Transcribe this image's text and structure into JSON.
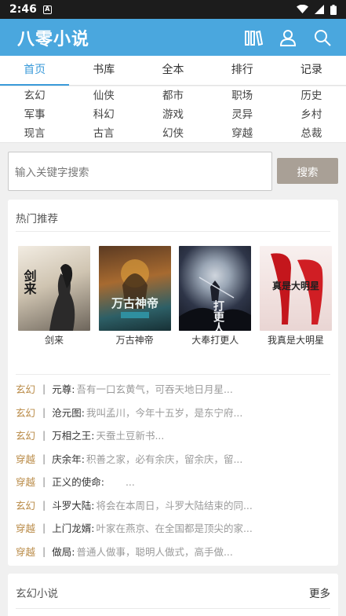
{
  "status": {
    "time": "2:46"
  },
  "app": {
    "title": "八零小说"
  },
  "tabs": [
    "首页",
    "书库",
    "全本",
    "排行",
    "记录"
  ],
  "categories": [
    "玄幻",
    "仙侠",
    "都市",
    "职场",
    "历史",
    "军事",
    "科幻",
    "游戏",
    "灵异",
    "乡村",
    "现言",
    "古言",
    "幻侠",
    "穿越",
    "总裁"
  ],
  "search": {
    "placeholder": "输入关键字搜索",
    "button": "搜索"
  },
  "hot": {
    "title": "热门推荐",
    "books": [
      {
        "name": "剑来",
        "cover_text": "剑来"
      },
      {
        "name": "万古神帝",
        "cover_text": "万古神帝"
      },
      {
        "name": "大奉打更人",
        "cover_text": "打更人"
      },
      {
        "name": "我真是大明星",
        "cover_text": "真是大明星"
      }
    ],
    "list": [
      {
        "tag": "玄幻",
        "title": "元尊:",
        "desc": "吾有一口玄黄气，可吞天地日月星..."
      },
      {
        "tag": "玄幻",
        "title": "沧元图:",
        "desc": "我叫孟川，今年十五岁，是东宁府..."
      },
      {
        "tag": "玄幻",
        "title": "万相之王:",
        "desc": "天蚕土豆新书..."
      },
      {
        "tag": "穿越",
        "title": "庆余年:",
        "desc": "积善之家，必有余庆，留余庆，留..."
      },
      {
        "tag": "穿越",
        "title": "正义的使命:",
        "desc": "　　..."
      },
      {
        "tag": "玄幻",
        "title": "斗罗大陆:",
        "desc": "将会在本周日，斗罗大陆结束的同..."
      },
      {
        "tag": "穿越",
        "title": "上门龙婿:",
        "desc": "叶家在燕京、在全国都是顶尖的家..."
      },
      {
        "tag": "穿越",
        "title": "做局:",
        "desc": "普通人做事，聪明人做式，高手做..."
      }
    ]
  },
  "section2": {
    "title": "玄幻小说",
    "more": "更多"
  },
  "colors": {
    "appbar": "#4aa7de",
    "accent": "#3a9ad9",
    "tag": "#b98a46",
    "search_button": "#a9a096"
  }
}
